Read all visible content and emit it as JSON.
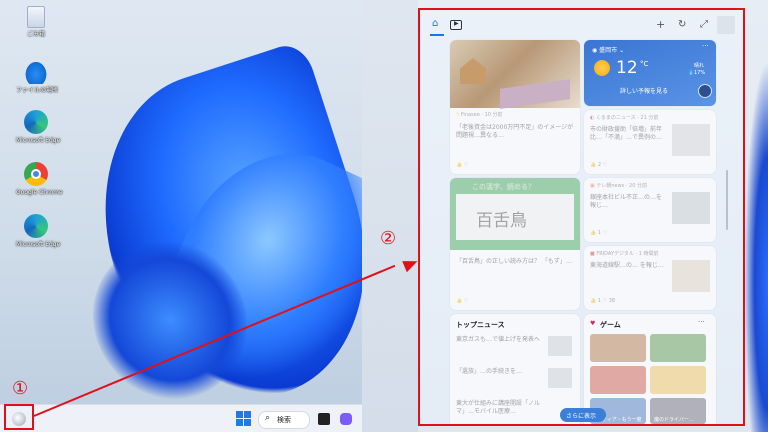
{
  "desktop": {
    "icons": [
      {
        "label": "ごみ箱",
        "icon": "recycle-bin-icon"
      },
      {
        "label": "ファイルの場所",
        "icon": "onedrive-icon"
      },
      {
        "label": "Microsoft Edge",
        "icon": "edge-icon"
      },
      {
        "label": "Google Chrome",
        "icon": "chrome-icon"
      },
      {
        "label": "Microsoft Edge",
        "icon": "edge-icon"
      }
    ]
  },
  "taskbar": {
    "search_label": "検索"
  },
  "annotations": {
    "one": "①",
    "two": "②"
  },
  "widgets": {
    "header": {
      "home_icon": "home-icon",
      "video_icon": "video-icon",
      "add": "+",
      "refresh": "↻",
      "expand": "⤢"
    },
    "weather": {
      "location": "盛岡市",
      "temp": "12",
      "unit": "°C",
      "condition": "晴れ",
      "rain": "17%",
      "link": "詳しい予報を見る"
    },
    "finance": {
      "source": "Finasee · 10 分前",
      "headline": "「老後資金は2000万円不足」のイメージが問題視…異なる…"
    },
    "news1": {
      "source": "くるまのニュース · 21 分前",
      "headline": "市の財政援助「倍増」前年比…「不満」…で異例の…",
      "likes": "2"
    },
    "quiz": {
      "banner": "この漢字、読める？",
      "kanji": "百舌鳥",
      "caption": "「百舌鳥」の正しい読み方は？ 「もず」…",
      "likes": ""
    },
    "news2": {
      "source": "テレ朝news · 20 分前",
      "headline": "銀座本社ビル不正…の…を報じ…",
      "likes": "1"
    },
    "news3": {
      "source": "FRIDAYデジタル · 1 時間前",
      "headline": "東海道線駅…の… を報じ…",
      "likes": "1",
      "comments": "38"
    },
    "top_news": {
      "title": "トップニュース",
      "items": [
        "東京ガスも…で値上げを発表へ",
        "「遺族」…の手続きを…",
        "東大が仕組みに講座開設「ノルマ」…モバイル医療…"
      ]
    },
    "games": {
      "title": "ゲーム",
      "item": "ソリティア・もう一度",
      "item2": "魔のドライバー…"
    },
    "more_button": "さらに表示"
  }
}
